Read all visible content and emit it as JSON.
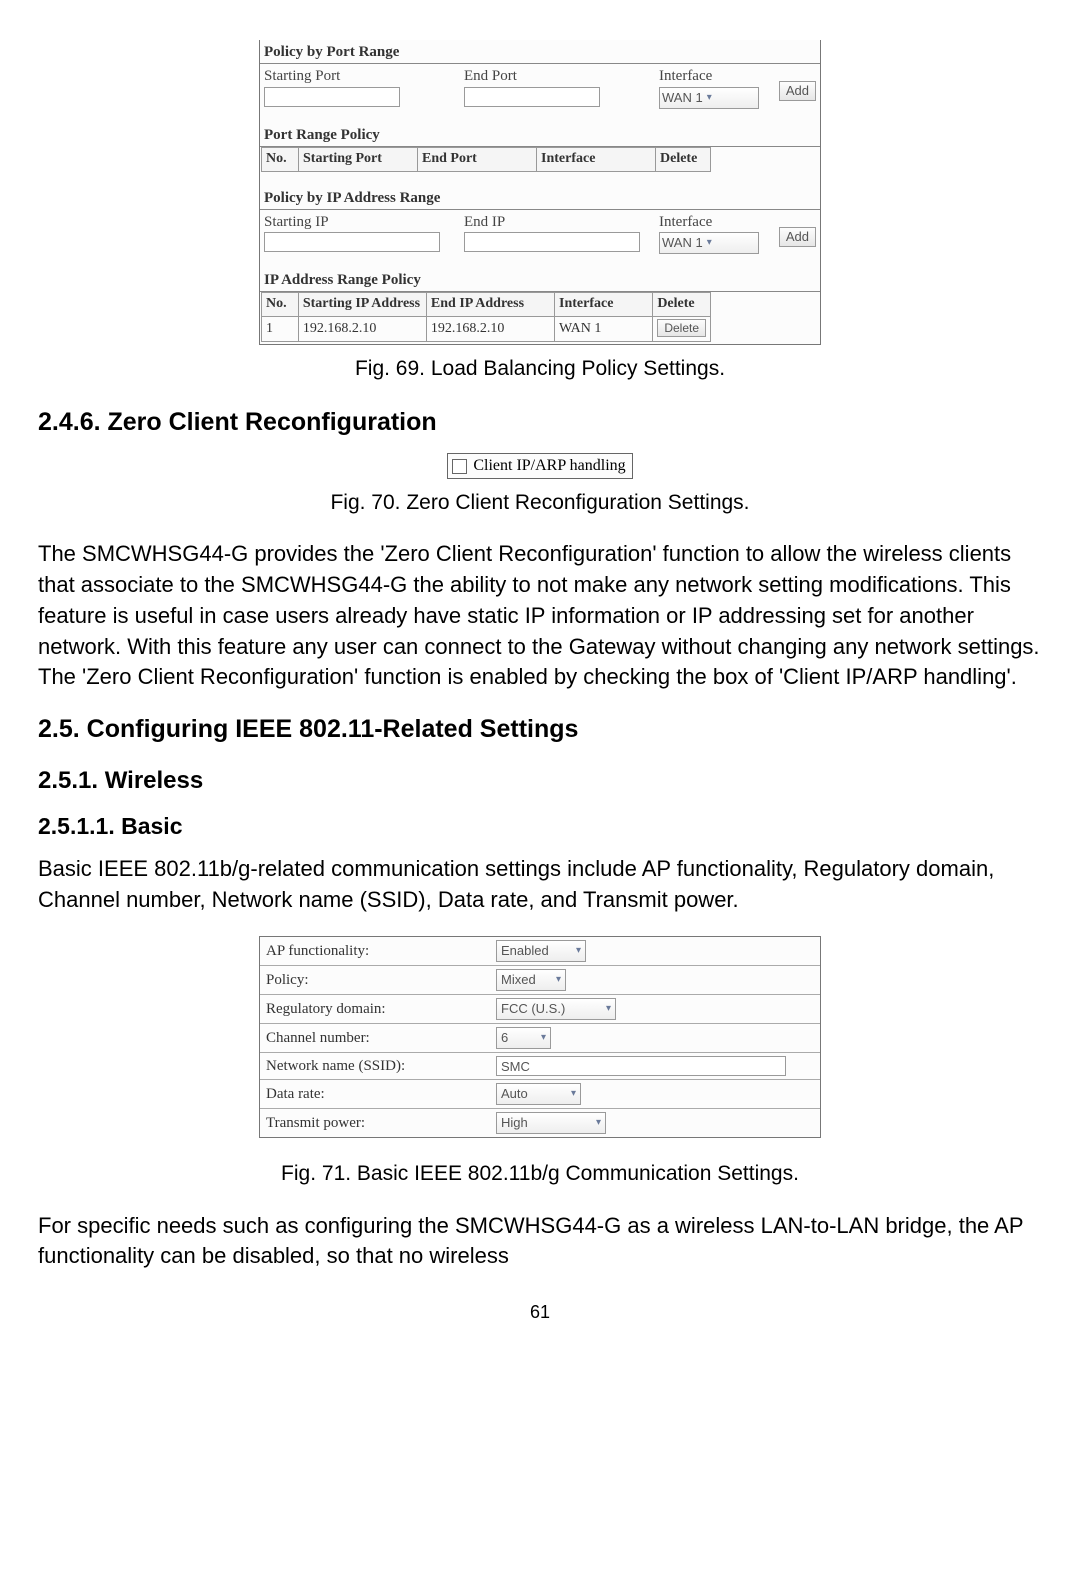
{
  "fig69": {
    "sections": {
      "policy_by_port_range": {
        "title": "Policy by Port Range",
        "starting_port_label": "Starting Port",
        "end_port_label": "End Port",
        "interface_label": "Interface",
        "interface_value": "WAN 1",
        "add_btn": "Add"
      },
      "port_range_policy": {
        "title": "Port Range Policy",
        "headers": {
          "no": "No.",
          "starting_port": "Starting Port",
          "end_port": "End Port",
          "interface": "Interface",
          "delete": "Delete"
        }
      },
      "policy_by_ip_range": {
        "title": "Policy by IP Address Range",
        "starting_ip_label": "Starting IP",
        "end_ip_label": "End IP",
        "interface_label": "Interface",
        "interface_value": "WAN 1",
        "add_btn": "Add"
      },
      "ip_address_range_policy": {
        "title": "IP Address Range Policy",
        "headers": {
          "no": "No.",
          "starting_ip": "Starting IP Address",
          "end_ip": "End IP Address",
          "interface": "Interface",
          "delete": "Delete"
        },
        "rows": [
          {
            "no": "1",
            "starting_ip": "192.168.2.10",
            "end_ip": "192.168.2.10",
            "interface": "WAN 1",
            "delete": "Delete"
          }
        ]
      }
    },
    "caption": "Fig. 69. Load Balancing Policy Settings."
  },
  "section_246": {
    "heading": "2.4.6. Zero Client Reconfiguration",
    "fig70": {
      "checkbox_label": "Client IP/ARP handling",
      "caption": "Fig. 70. Zero Client Reconfiguration Settings."
    },
    "paragraph": "The SMCWHSG44-G provides the 'Zero Client Reconfiguration' function to allow the wireless clients that associate to the SMCWHSG44-G the ability to not make any network setting modifications. This feature is useful in case users already have static IP information or IP addressing set for another network. With this feature any user can connect to the Gateway without changing any network settings. The 'Zero Client Reconfiguration' function is enabled by checking the box of 'Client IP/ARP handling'."
  },
  "section_25": {
    "heading": "2.5. Configuring IEEE 802.11-Related Settings",
    "sub_251": "2.5.1. Wireless",
    "sub_2511": "2.5.1.1. Basic",
    "intro": "Basic IEEE 802.11b/g-related communication settings include AP functionality, Regulatory domain, Channel number, Network name (SSID), Data rate, and Transmit power.",
    "fig71": {
      "rows": {
        "ap_func": {
          "label": "AP functionality:",
          "value": "Enabled"
        },
        "policy": {
          "label": "Policy:",
          "value": "Mixed"
        },
        "reg_domain": {
          "label": "Regulatory domain:",
          "value": "FCC (U.S.)"
        },
        "channel": {
          "label": "Channel number:",
          "value": "6"
        },
        "ssid": {
          "label": "Network name (SSID):",
          "value": "SMC"
        },
        "data_rate": {
          "label": "Data rate:",
          "value": "Auto"
        },
        "tx_power": {
          "label": "Transmit power:",
          "value": "High"
        }
      },
      "caption": "Fig. 71. Basic IEEE 802.11b/g Communication Settings."
    },
    "outro": "For specific needs such as configuring the SMCWHSG44-G as a wireless LAN-to-LAN bridge, the AP functionality can be disabled, so that no wireless"
  },
  "page_number": "61"
}
